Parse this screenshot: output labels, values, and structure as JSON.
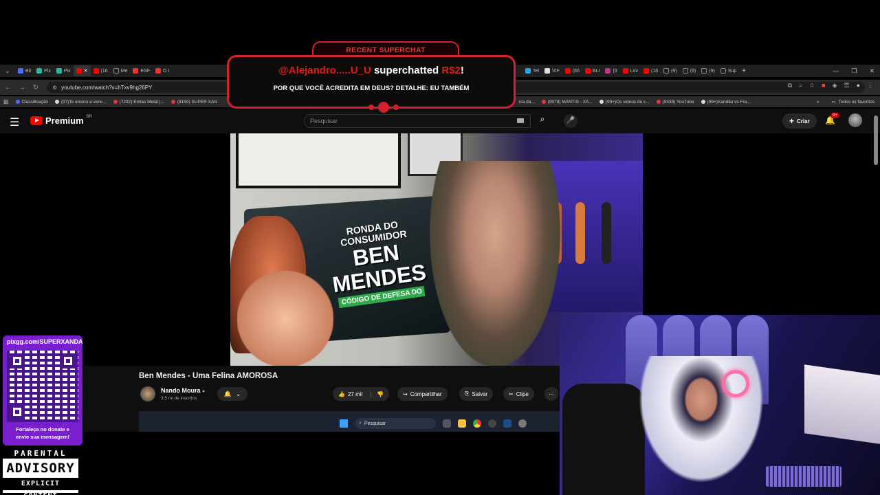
{
  "browser": {
    "tabs_left": [
      "Bit",
      "Pix",
      "Pix",
      "",
      "(16",
      "Me",
      "ESF",
      "O I"
    ],
    "tabs_right": [
      "Tel",
      "VIF",
      "(66",
      "BLI",
      "(9",
      "Lov",
      "(16",
      "(9)",
      "(9)",
      "(9)",
      "Sup"
    ],
    "url": "youtube.com/watch?v=hTxv9hg26PY",
    "bookmarks": [
      "Classificação",
      "(97)Te ensino a venc...",
      "(7292) Emlas Metal |...",
      "(8159) SUPER XAN"
    ],
    "bookmarks_right": [
      "ica da...",
      "(9078) MANTIS - XA...",
      "(99+)Os videos de c...",
      "(9338) YouTube",
      "(99+)Xandão vs Fra..."
    ],
    "favorites_label": "Todos os favoritos"
  },
  "youtube": {
    "brand": "Premium",
    "country": "BR",
    "search_placeholder": "Pesquisar",
    "create_label": "Criar",
    "notif_badge": "9+",
    "video_title": "Ben Mendes - Uma Felina AMOROSA",
    "channel_name": "Nando Moura",
    "channel_subs": "3,5 mi de inscritos",
    "likes": "27 mil",
    "share_label": "Compartilhar",
    "save_label": "Salvar",
    "clip_label": "Clipe",
    "thumbnail": {
      "line1": "RONDA DO",
      "line2": "CONSUMIDOR",
      "big1": "BEN",
      "big2": "MENDES",
      "tag": "CÓDIGO DE DEFESA DO"
    }
  },
  "taskbar": {
    "search_placeholder": "Pesquisar"
  },
  "superchat": {
    "header": "RECENT SUPERCHAT",
    "user": "@Alejandro.....U_U",
    "action": "superchatted",
    "amount": "R$2",
    "message": "POR QUE VOCÊ ACREDITA EM DEUS? DETALHE: EU TAMBÉM"
  },
  "donate": {
    "url": "pixgg.com/SUPERXANDA",
    "message_line1": "Fortaleça no donate e",
    "message_line2": "envie sua mensagem!"
  },
  "advisory": {
    "top": "PARENTAL",
    "mid": "ADVISORY",
    "bot": "EXPLICIT CONTENT"
  },
  "colors": {
    "superchat_red": "#d2222d",
    "yt_red": "#ff0000",
    "donate_purple": "#7a1fd0"
  }
}
